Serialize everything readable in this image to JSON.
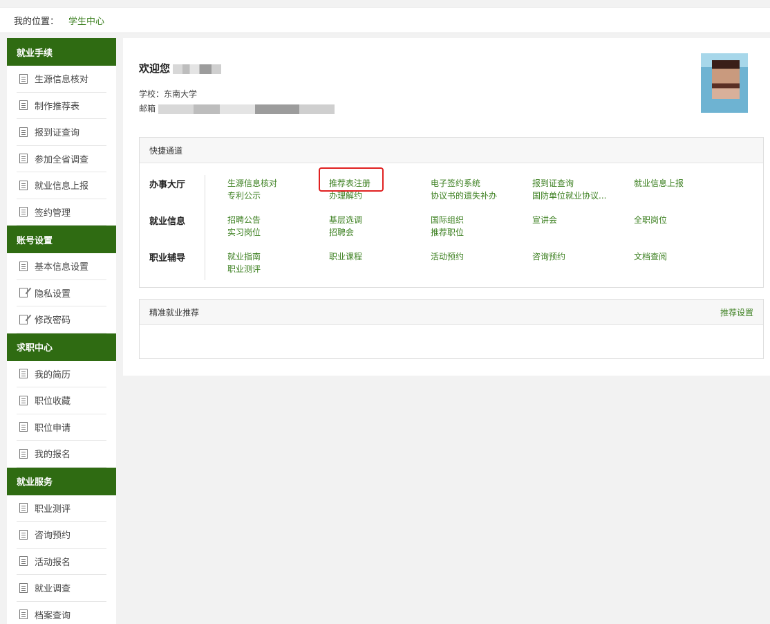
{
  "breadcrumb": {
    "label": "我的位置：",
    "current": "学生中心"
  },
  "sidebar": [
    {
      "title": "就业手续",
      "items": [
        {
          "label": "生源信息核对",
          "icon": "doc-icon"
        },
        {
          "label": "制作推荐表",
          "icon": "doc-icon"
        },
        {
          "label": "报到证查询",
          "icon": "doc-icon"
        },
        {
          "label": "参加全省调查",
          "icon": "doc-icon"
        },
        {
          "label": "就业信息上报",
          "icon": "doc-icon"
        },
        {
          "label": "签约管理",
          "icon": "doc-icon"
        }
      ]
    },
    {
      "title": "账号设置",
      "items": [
        {
          "label": "基本信息设置",
          "icon": "doc-icon"
        },
        {
          "label": "隐私设置",
          "icon": "edit-icon"
        },
        {
          "label": "修改密码",
          "icon": "edit-icon"
        }
      ]
    },
    {
      "title": "求职中心",
      "items": [
        {
          "label": "我的简历",
          "icon": "doc-icon"
        },
        {
          "label": "职位收藏",
          "icon": "doc-icon"
        },
        {
          "label": "职位申请",
          "icon": "doc-icon"
        },
        {
          "label": "我的报名",
          "icon": "doc-icon"
        }
      ]
    },
    {
      "title": "就业服务",
      "items": [
        {
          "label": "职业测评",
          "icon": "doc-icon"
        },
        {
          "label": "咨询预约",
          "icon": "doc-icon"
        },
        {
          "label": "活动报名",
          "icon": "doc-icon"
        },
        {
          "label": "就业调查",
          "icon": "doc-icon"
        },
        {
          "label": "档案查询",
          "icon": "doc-icon"
        }
      ]
    }
  ],
  "profile": {
    "welcome": "欢迎您",
    "school_label": "学校：",
    "school_value": "东南大学",
    "email_label": "邮箱"
  },
  "quick": {
    "title": "快捷通道",
    "categories": [
      {
        "name": "办事大厅",
        "links": [
          "生源信息核对",
          "推荐表注册",
          "电子签约系统",
          "报到证查询",
          "就业信息上报",
          "专利公示",
          "办理解约",
          "协议书的遗失补办",
          "国防单位就业协议..."
        ]
      },
      {
        "name": "就业信息",
        "links": [
          "招聘公告",
          "基层选调",
          "国际组织",
          "宣讲会",
          "全职岗位",
          "实习岗位",
          "招聘会",
          "推荐职位"
        ]
      },
      {
        "name": "职业辅导",
        "links": [
          "就业指南",
          "职业课程",
          "活动预约",
          "咨询预约",
          "文档查阅",
          "职业测评"
        ]
      }
    ]
  },
  "jobs": {
    "title": "精准就业推荐",
    "action": "推荐设置"
  },
  "colors": {
    "accent": "#2f6b12",
    "link": "#3b7f1f",
    "highlight_box": "#e02020"
  }
}
